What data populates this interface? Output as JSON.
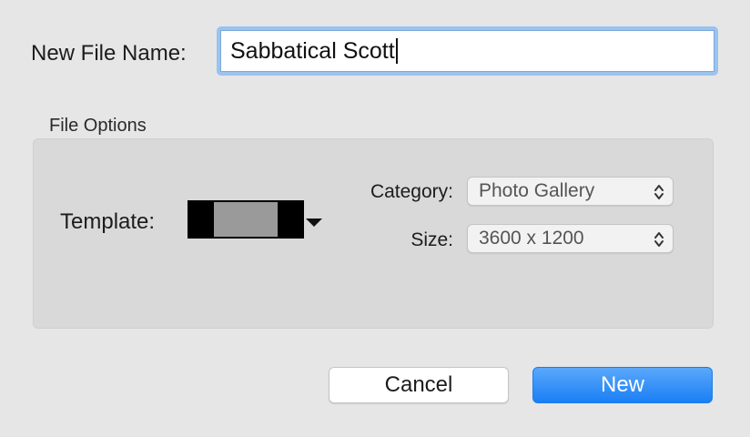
{
  "new_file_name": {
    "label": "New File Name:",
    "value": "Sabbatical Scott"
  },
  "file_options": {
    "title": "File Options",
    "template_label": "Template:",
    "category": {
      "label": "Category:",
      "selected": "Photo Gallery"
    },
    "size": {
      "label": "Size:",
      "selected": "3600 x 1200"
    }
  },
  "buttons": {
    "cancel_label": "Cancel",
    "new_label": "New"
  },
  "colors": {
    "accent": "#1a7ff5",
    "focus_ring": "#9cc2ee"
  },
  "icons": {
    "template_menu": "triangle-down-icon",
    "popup_stepper": "up-down-chevron-icon"
  }
}
